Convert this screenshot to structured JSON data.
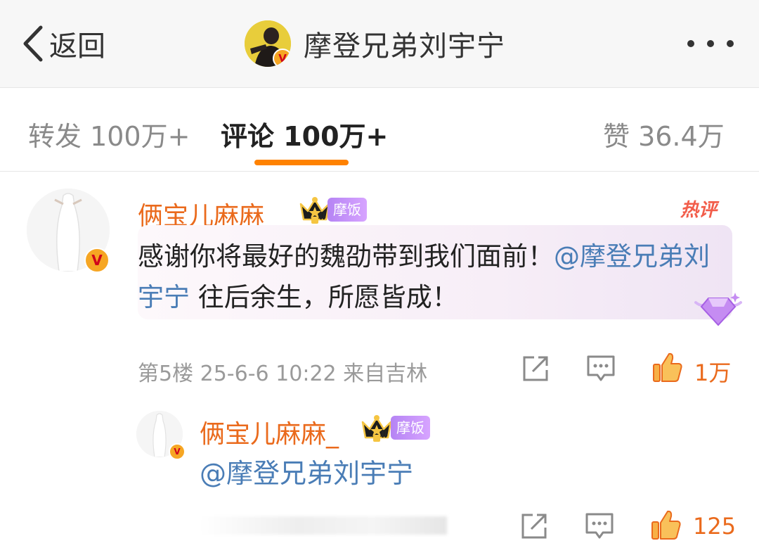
{
  "header": {
    "back_label": "返回",
    "title": "摩登兄弟刘宇宁",
    "verified_mark": "V"
  },
  "tabs": [
    {
      "label": "转发 100万+",
      "active": false
    },
    {
      "label": "评论 100万+",
      "active": true
    },
    {
      "label": "赞 36.4万",
      "active": false
    }
  ],
  "comments": [
    {
      "username": "俩宝儿麻麻_",
      "crown_level": "Ⅱ",
      "fan_badge": "摩饭",
      "hot_label": "热评",
      "text_before": "感谢你将最好的魏劭带到我们面前！",
      "mention": "@摩登兄弟刘宇宁",
      "text_after": " 往后余生，所愿皆成！",
      "meta": "第5楼 25-6-6 10:22 来自吉林",
      "likes": "1万",
      "verified_mark": "V"
    }
  ],
  "reply": {
    "username": "俩宝儿麻麻_",
    "crown_level": "Ⅱ",
    "fan_badge": "摩饭",
    "text": "@摩登兄弟刘宇宁",
    "likes": "125",
    "verified_mark": "V"
  },
  "colors": {
    "accent": "#ff8200",
    "username": "#ea6a1c",
    "mention": "#4a7db6",
    "hot": "#f25d4a"
  },
  "icons": [
    "back-chevron-icon",
    "more-dots-icon",
    "share-icon",
    "comment-icon",
    "like-icon",
    "crown-icon",
    "diamond-icon"
  ]
}
